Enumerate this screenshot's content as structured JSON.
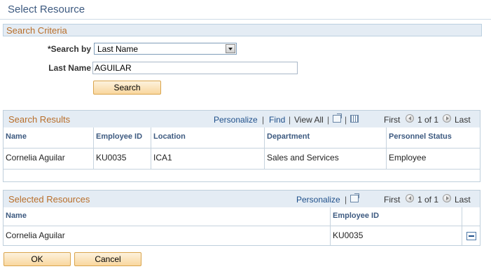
{
  "page": {
    "title": "Select Resource"
  },
  "search_criteria": {
    "section_title": "Search Criteria",
    "search_by_label": "*Search by",
    "search_by_value": "Last Name",
    "last_name_label": "Last Name",
    "last_name_value": "AGUILAR",
    "search_button": "Search"
  },
  "search_results": {
    "title": "Search Results",
    "personalize": "Personalize",
    "sep": "|",
    "find": "Find",
    "view_all": "View All",
    "first": "First",
    "range": "1 of 1",
    "last": "Last",
    "columns": [
      "Name",
      "Employee ID",
      "Location",
      "Department",
      "Personnel Status"
    ],
    "rows": [
      {
        "name": "Cornelia Aguilar",
        "employee_id": "KU0035",
        "location": "ICA1",
        "department": "Sales and Services",
        "status": "Employee"
      }
    ]
  },
  "selected_resources": {
    "title": "Selected Resources",
    "personalize": "Personalize",
    "sep": "|",
    "first": "First",
    "range": "1 of 1",
    "last": "Last",
    "columns": [
      "Name",
      "Employee ID"
    ],
    "rows": [
      {
        "name": "Cornelia Aguilar",
        "employee_id": "KU0035"
      }
    ]
  },
  "footer": {
    "ok": "OK",
    "cancel": "Cancel"
  },
  "colors": {
    "section_title": "#b86e2a",
    "link": "#1e4f8a",
    "button": "#f9d79e"
  },
  "icons": [
    "dropdown-arrow-icon",
    "zoom-grid-icon",
    "download-grid-icon",
    "first-arrow-icon",
    "last-arrow-icon",
    "remove-row-icon"
  ]
}
